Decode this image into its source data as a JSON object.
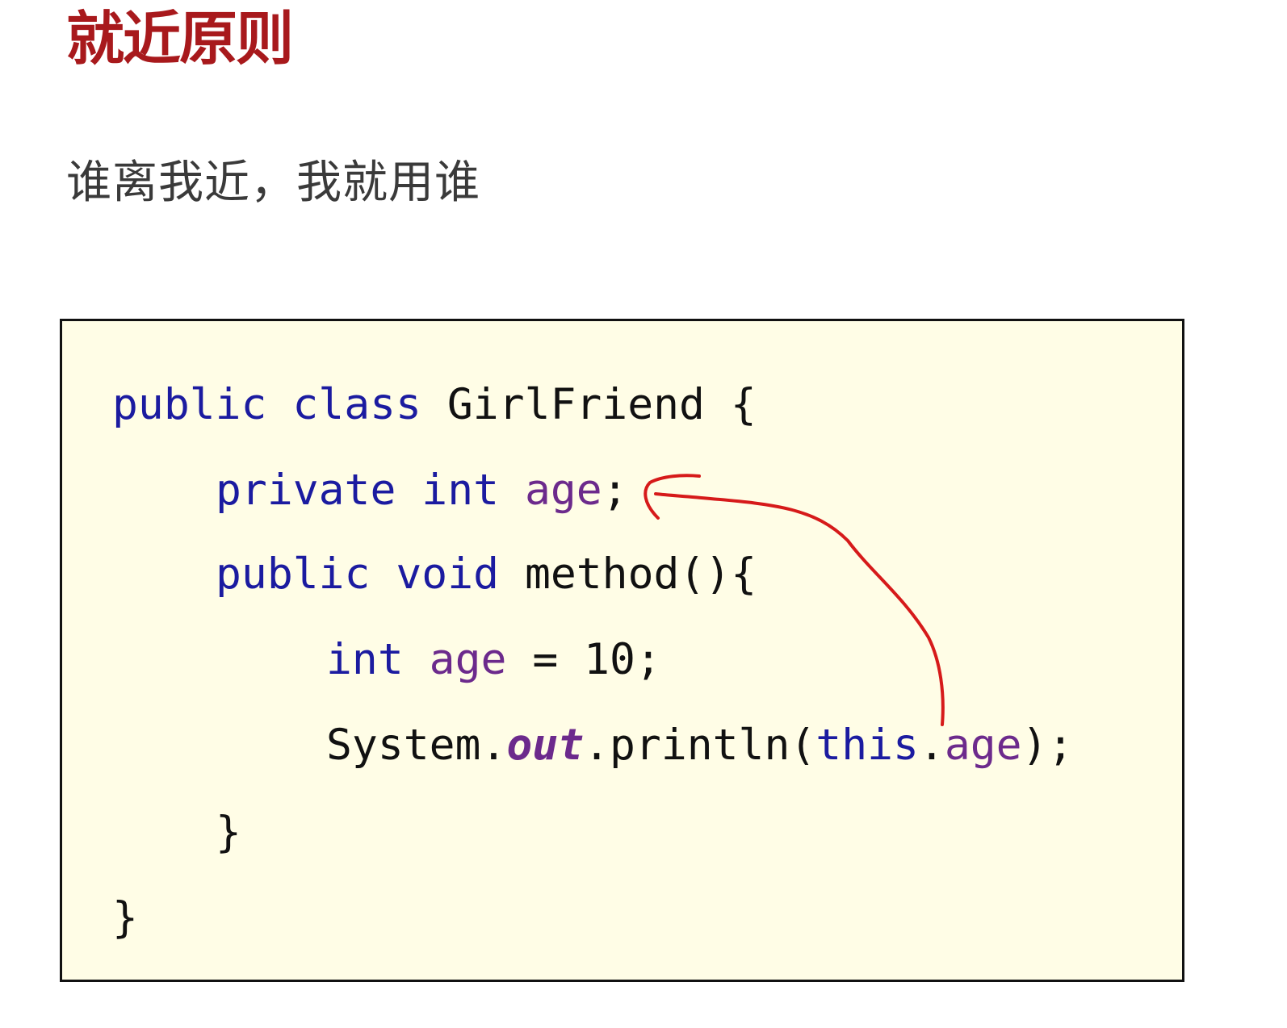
{
  "slide": {
    "title": "就近原则",
    "subtitle": "谁离我近，我就用谁",
    "title_color": "#a8191c",
    "code_background": "#fffde6",
    "annotation_color": "#d61a1a"
  },
  "code": {
    "line1": {
      "kw1": "public",
      "kw2": "class",
      "name": "GirlFriend",
      "brace": "{"
    },
    "line2": {
      "kw1": "private",
      "kw2": "int",
      "field": "age",
      "semi": ";"
    },
    "line3": {
      "kw1": "public",
      "kw2": "void",
      "name": "method(){"
    },
    "line4": {
      "kw1": "int",
      "field": "age",
      "rest": "= 10;"
    },
    "line5": {
      "obj": "System.",
      "static_field": "out",
      "call": ".println(",
      "kw": "this",
      "dot": ".",
      "field": "age",
      "end": ");"
    },
    "line6": {
      "brace": "}"
    },
    "line7": {
      "brace": "}"
    }
  },
  "annotation": {
    "icon": "hand-drawn-arrow-icon"
  }
}
